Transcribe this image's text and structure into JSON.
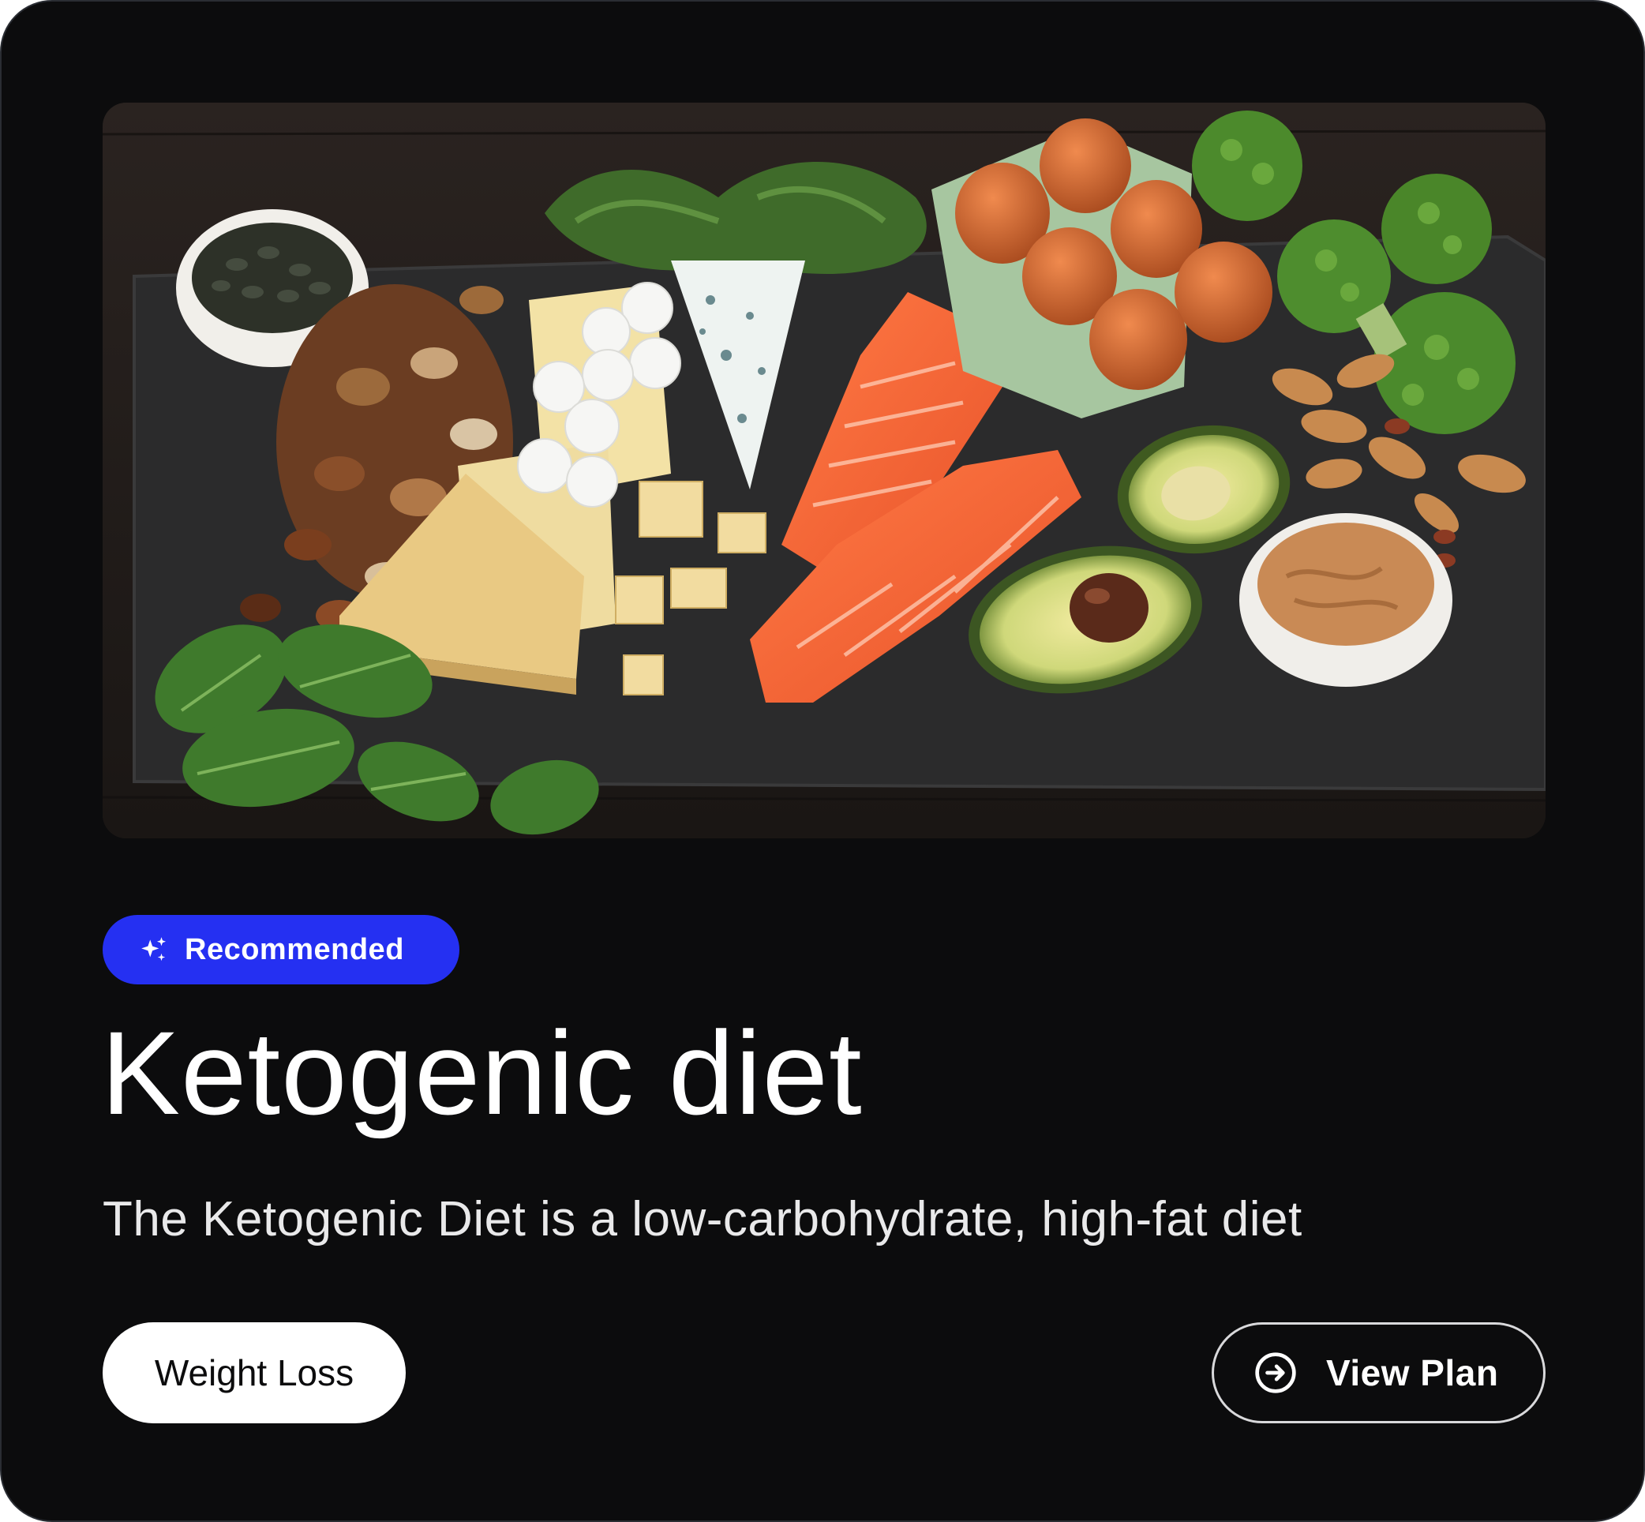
{
  "card": {
    "image_alt": "Keto foods: nuts, cheeses, salmon, eggs, avocado, broccoli, spinach and peanut butter on a slate board",
    "badge": {
      "icon": "sparkle-icon",
      "label": "Recommended",
      "color": "#2530f2"
    },
    "title": "Ketogenic diet",
    "description": "The Ketogenic Diet is a low-carbohydrate, high-fat diet",
    "tag": "Weight Loss",
    "action": {
      "icon": "arrow-right-circle-icon",
      "label": "View Plan"
    }
  }
}
